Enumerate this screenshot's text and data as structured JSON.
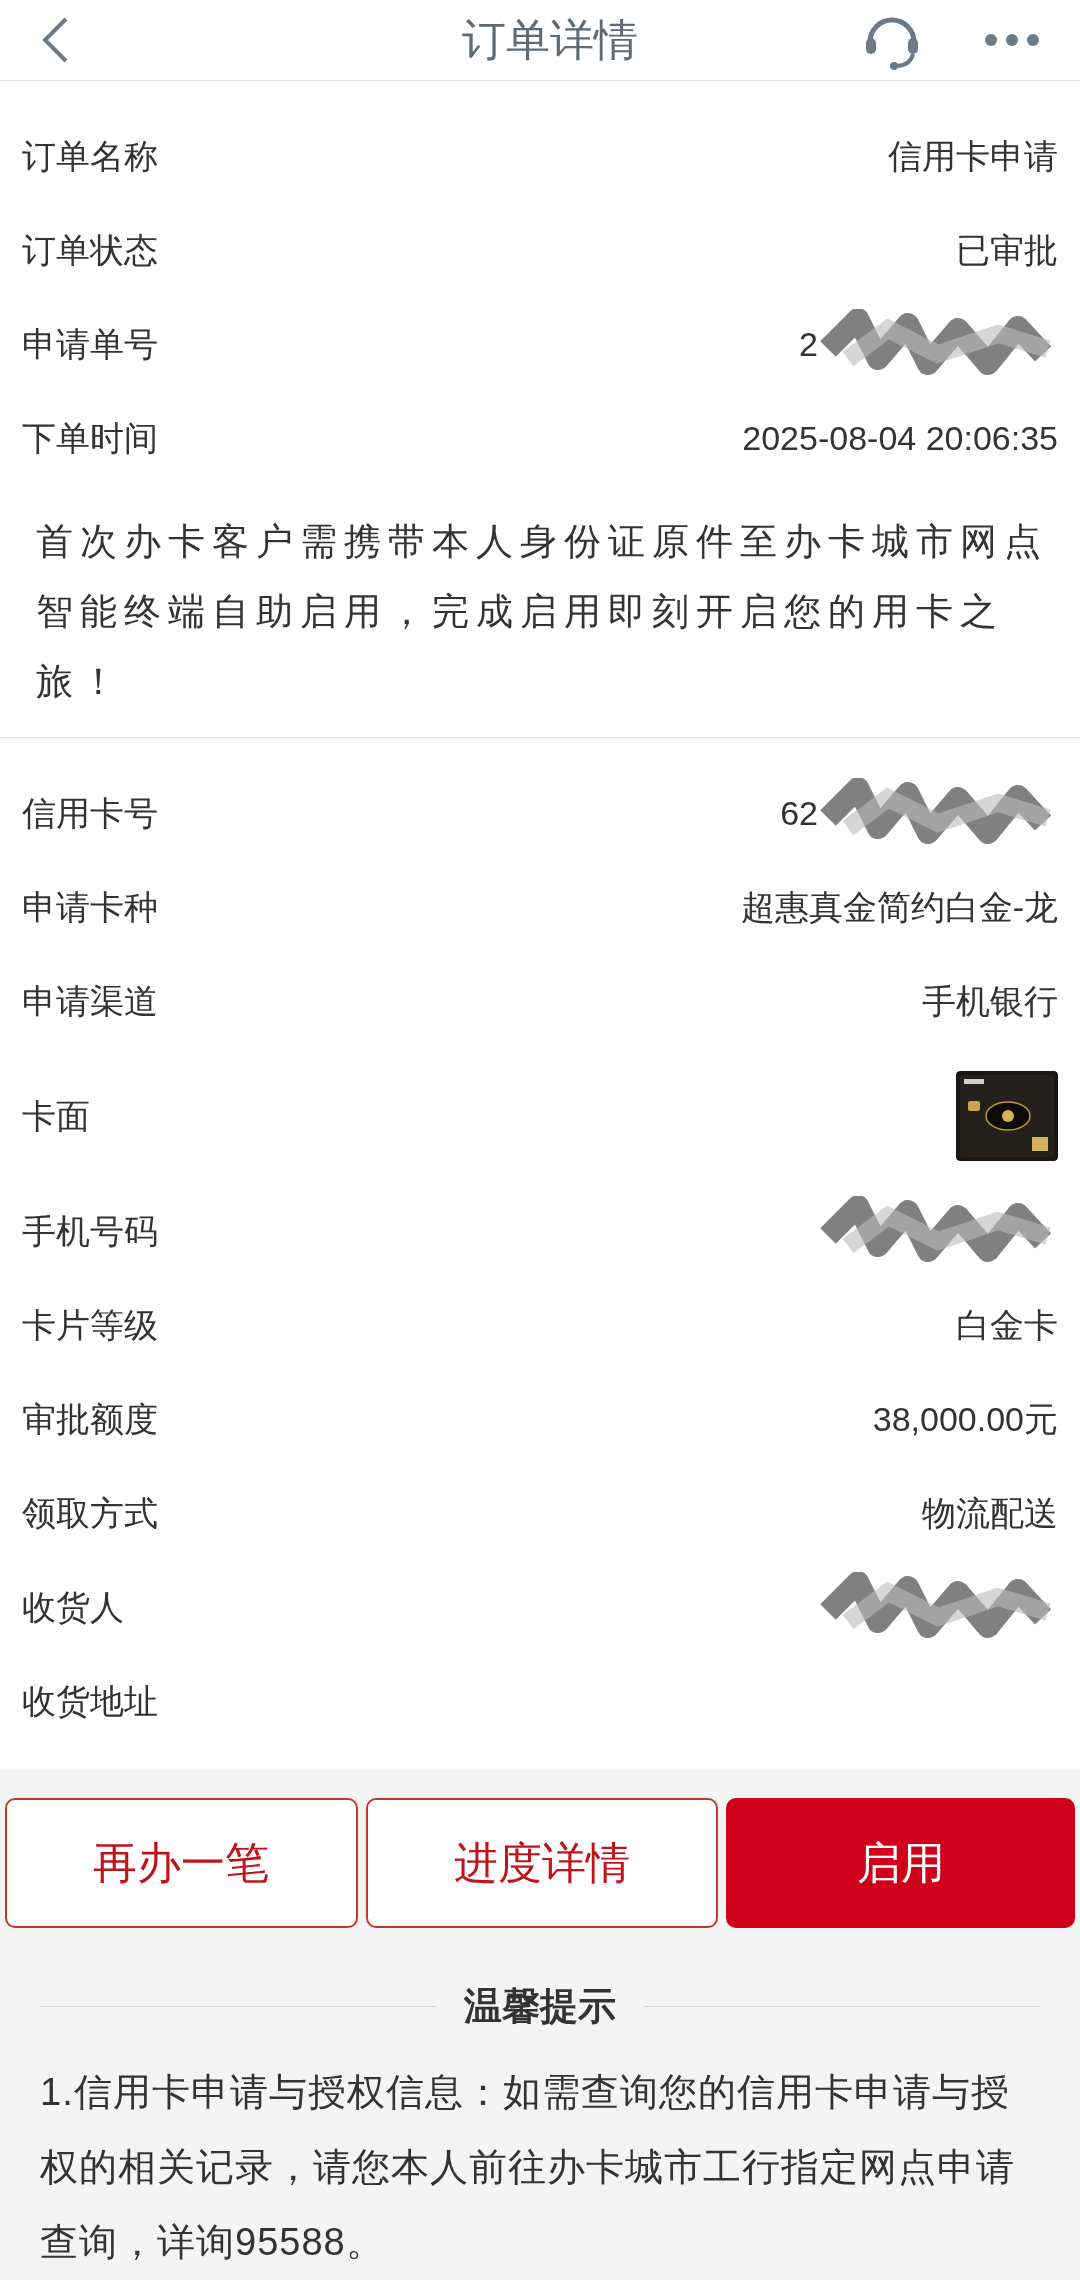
{
  "header": {
    "title": "订单详情"
  },
  "order_section": {
    "rows": [
      {
        "label": "订单名称",
        "kind": "text",
        "value": "信用卡申请"
      },
      {
        "label": "订单状态",
        "kind": "text",
        "value": "已审批"
      },
      {
        "label": "申请单号",
        "kind": "text",
        "value": "2",
        "redacted": true
      },
      {
        "label": "下单时间",
        "kind": "text",
        "value": "2025-08-04 20:06:35"
      }
    ],
    "notice": "首次办卡客户需携带本人身份证原件至办卡城市网点智能终端自助启用，完成启用即刻开启您的用卡之旅！"
  },
  "card_section": {
    "rows": [
      {
        "label": "信用卡号",
        "kind": "text",
        "value": "62",
        "redacted": true
      },
      {
        "label": "申请卡种",
        "kind": "text",
        "value": "超惠真金简约白金-龙"
      },
      {
        "label": "申请渠道",
        "kind": "text",
        "value": "手机银行"
      },
      {
        "label": "卡面"
      },
      {
        "label": "手机号码",
        "kind": "text",
        "redacted": true
      },
      {
        "label": "卡片等级",
        "kind": "text",
        "value": "白金卡"
      },
      {
        "label": "审批额度",
        "kind": "text",
        "value": "38,000.00元"
      },
      {
        "label": "领取方式",
        "kind": "text",
        "value": "物流配送"
      },
      {
        "label": "收货人",
        "kind": "text",
        "redacted": true
      },
      {
        "label": "收货地址",
        "kind": "text"
      }
    ]
  },
  "buttons": [
    {
      "label": "再办一笔",
      "primary": false
    },
    {
      "label": "进度详情",
      "primary": false
    },
    {
      "label": "启用",
      "primary": true
    }
  ],
  "tips": {
    "title": "温馨提示",
    "text": "1.信用卡申请与授权信息：如需查询您的信用卡申请与授权的相关记录，请您本人前往办卡城市工行指定网点申请查询，详询95588。"
  }
}
